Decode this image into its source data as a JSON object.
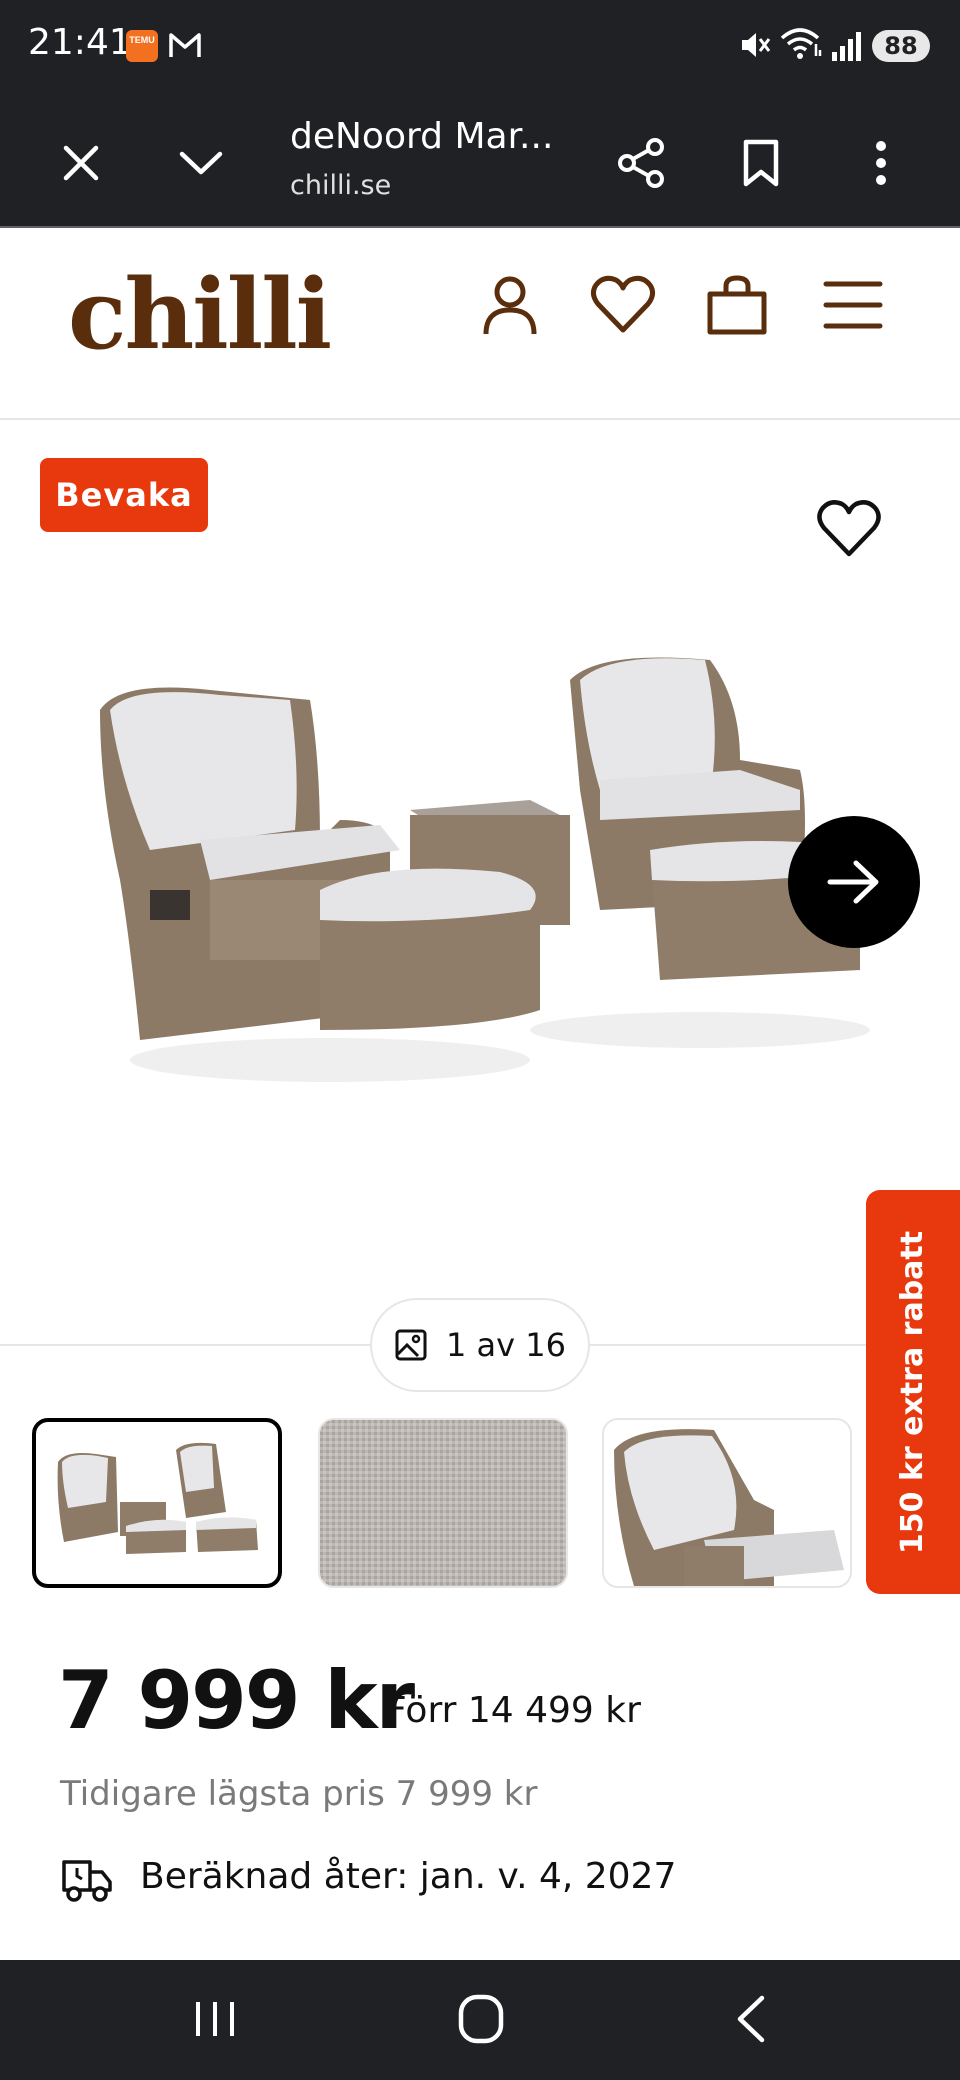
{
  "status_bar": {
    "time": "21:41",
    "battery": "88",
    "temu_label": "TEMU"
  },
  "browser": {
    "title": "deNoord Mar...",
    "domain": "chilli.se"
  },
  "site": {
    "logo": "chilli"
  },
  "product": {
    "badge": "Bevaka",
    "image_counter": "1 av 16",
    "price": "7 999 kr",
    "old_price": "Förr 14 499 kr",
    "lowest_price": "Tidigare lägsta pris 7 999 kr",
    "delivery": "Beräknad åter: jan. v. 4, 2027"
  },
  "promo": {
    "text": "150 kr extra rabatt"
  },
  "colors": {
    "accent": "#e8380d",
    "brand": "#5a2d0c",
    "chrome": "#202124"
  }
}
